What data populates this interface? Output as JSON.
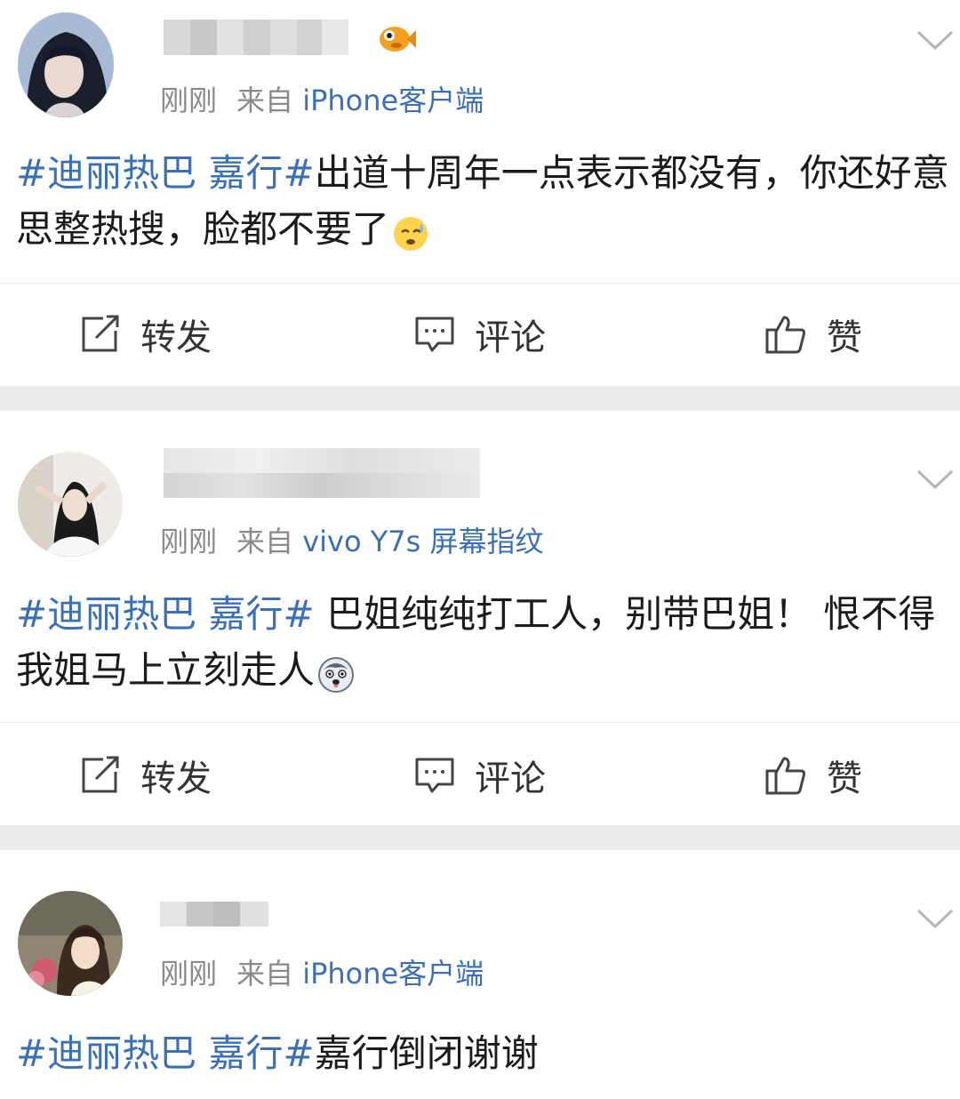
{
  "posts": [
    {
      "time": "刚刚",
      "source_prefix": "来自",
      "device": "iPhone客户端",
      "topic": "#迪丽热巴 嘉行#",
      "text": "出道十周年一点表示都没有，你还好意思整热搜，脸都不要了",
      "has_badge": true,
      "emoji": "sweat-emoji"
    },
    {
      "time": "刚刚",
      "source_prefix": "来自",
      "device": "vivo Y7s 屏幕指纹",
      "topic": "#迪丽热巴 嘉行#",
      "text": " 巴姐纯纯打工人，别带巴姐！ 恨不得我姐马上立刻走人",
      "has_badge": false,
      "emoji": "husky-emoji"
    },
    {
      "time": "刚刚",
      "source_prefix": "来自",
      "device": "iPhone客户端",
      "topic": "#迪丽热巴 嘉行#",
      "text": "嘉行倒闭谢谢",
      "has_badge": false,
      "emoji": ""
    }
  ],
  "actions": {
    "repost_label": "转发",
    "comment_label": "评论",
    "like_label": "赞"
  },
  "colors": {
    "topic": "#3b6fb6",
    "meta": "#8a8a8a",
    "separator": "#ececec"
  }
}
